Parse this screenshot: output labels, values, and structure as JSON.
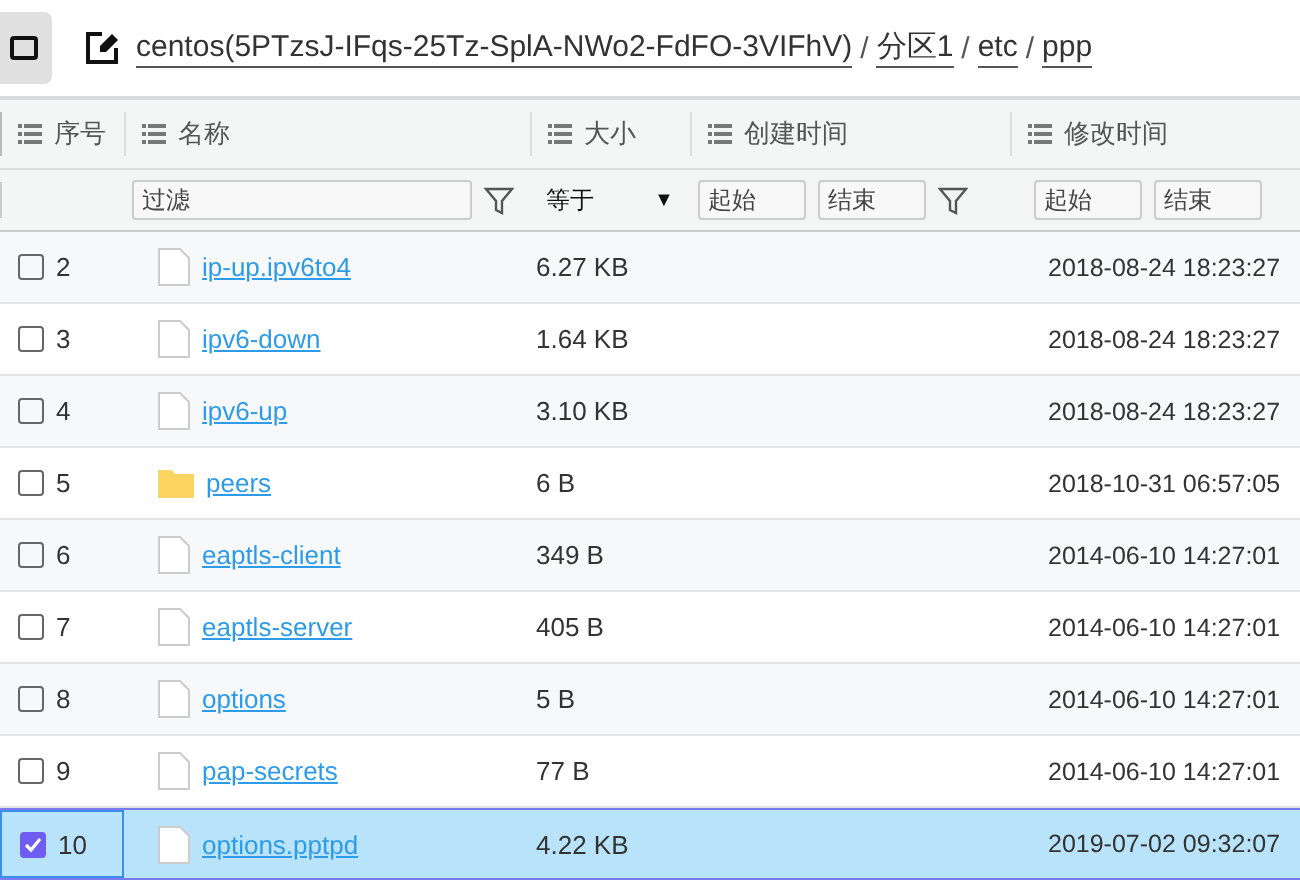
{
  "breadcrumb": [
    {
      "label": "centos(5PTzsJ-IFqs-25Tz-SplA-NWo2-FdFO-3VIFhV)"
    },
    {
      "label": "分区1"
    },
    {
      "label": "etc"
    },
    {
      "label": "ppp"
    }
  ],
  "separators": [
    "/",
    "/",
    "/"
  ],
  "columns": [
    {
      "label": "序号"
    },
    {
      "label": "名称"
    },
    {
      "label": "大小"
    },
    {
      "label": "创建时间"
    },
    {
      "label": "修改时间"
    }
  ],
  "filters": {
    "name": {
      "placeholder": "过滤"
    },
    "size_operator": {
      "value": "等于",
      "caret": "▼"
    },
    "created": {
      "start": {
        "placeholder": "起始"
      },
      "end": {
        "placeholder": "结束"
      }
    },
    "modified": {
      "start": {
        "placeholder": "起始"
      },
      "end": {
        "placeholder": "结束"
      }
    }
  },
  "rows": [
    {
      "index": "2",
      "kind": "file",
      "name": "ip-up.ipv6to4",
      "size": "6.27 KB",
      "modified": "2018-08-24 18:23:27",
      "selected": false
    },
    {
      "index": "3",
      "kind": "file",
      "name": "ipv6-down",
      "size": "1.64 KB",
      "modified": "2018-08-24 18:23:27",
      "selected": false
    },
    {
      "index": "4",
      "kind": "file",
      "name": "ipv6-up",
      "size": "3.10 KB",
      "modified": "2018-08-24 18:23:27",
      "selected": false
    },
    {
      "index": "5",
      "kind": "folder",
      "name": "peers",
      "size": "6 B",
      "modified": "2018-10-31 06:57:05",
      "selected": false
    },
    {
      "index": "6",
      "kind": "file",
      "name": "eaptls-client",
      "size": "349 B",
      "modified": "2014-06-10 14:27:01",
      "selected": false
    },
    {
      "index": "7",
      "kind": "file",
      "name": "eaptls-server",
      "size": "405 B",
      "modified": "2014-06-10 14:27:01",
      "selected": false
    },
    {
      "index": "8",
      "kind": "file",
      "name": "options",
      "size": "5 B",
      "modified": "2014-06-10 14:27:01",
      "selected": false
    },
    {
      "index": "9",
      "kind": "file",
      "name": "pap-secrets",
      "size": "77 B",
      "modified": "2014-06-10 14:27:01",
      "selected": false
    },
    {
      "index": "10",
      "kind": "file",
      "name": "options.pptpd",
      "size": "4.22 KB",
      "modified": "2019-07-02 09:32:07",
      "selected": true
    }
  ]
}
